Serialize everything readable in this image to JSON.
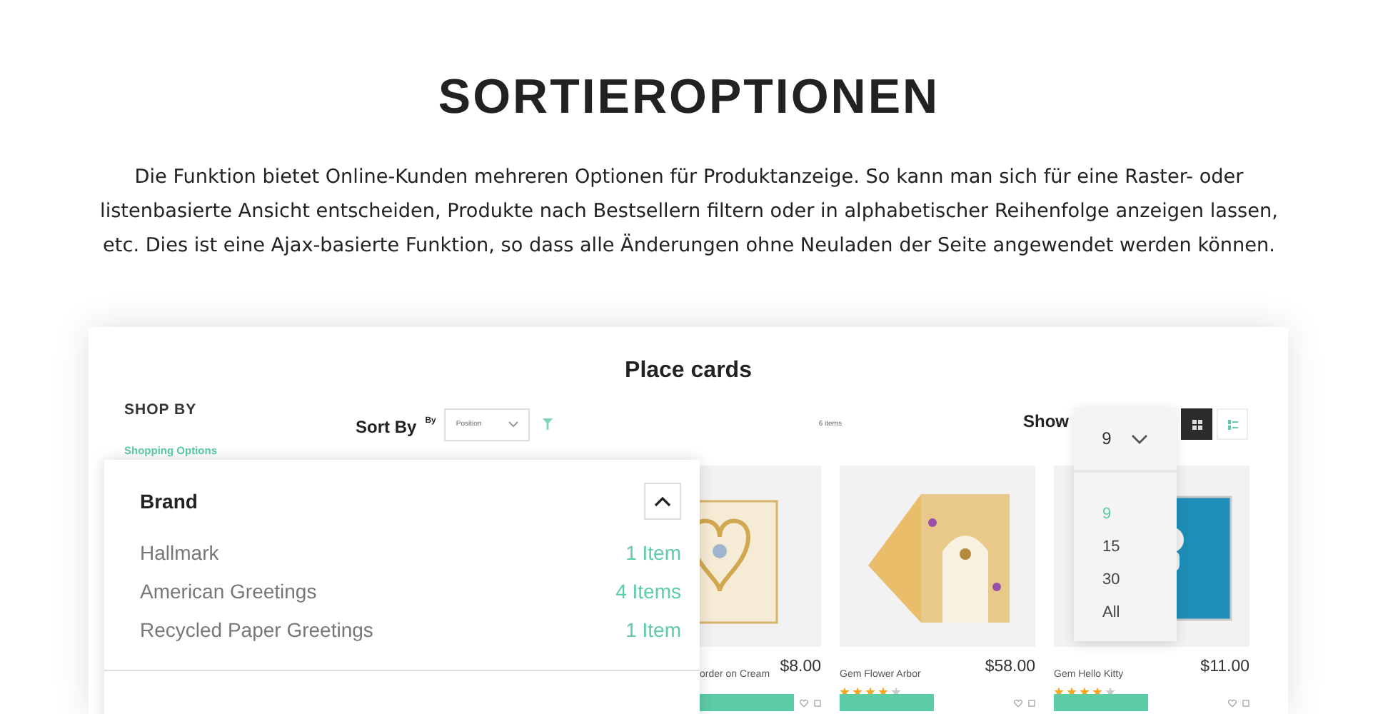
{
  "heading": "SORTIEROPTIONEN",
  "description": "Die Funktion bietet Online-Kunden mehreren Optionen für Produktanzeige. So kann man sich für eine Raster- oder listenbasierte Ansicht entscheiden, Produkte nach Bestsellern filtern oder in alphabetischer Reihenfolge anzeigen lassen, etc. Dies ist eine Ajax-basierte Funktion, so dass alle Änderungen ohne Neuladen der Seite angewendet werden können.",
  "shop": {
    "title": "Place cards",
    "shop_by": "SHOP BY",
    "shopping_options": "Shopping Options",
    "sort": {
      "label": "Sort By",
      "by": "By",
      "value": "Position"
    },
    "count": "6 items",
    "show": {
      "label": "Show",
      "value": "9",
      "options": [
        {
          "label": "9",
          "selected": true
        },
        {
          "label": "15",
          "selected": false
        },
        {
          "label": "30",
          "selected": false
        },
        {
          "label": "All",
          "selected": false
        }
      ]
    },
    "views": [
      {
        "kind": "grid",
        "selected": true
      },
      {
        "kind": "list",
        "selected": false
      }
    ],
    "brand": {
      "title": "Brand",
      "expanded": true,
      "items": [
        {
          "name": "Hallmark",
          "count": "1 Item"
        },
        {
          "name": "American Greetings",
          "count": "4 Items"
        },
        {
          "name": "Recycled Paper Greetings",
          "count": "1 Item"
        }
      ]
    },
    "products": [
      {
        "kind": "heart",
        "name": "order on Cream",
        "price": "$8.00"
      },
      {
        "kind": "arch",
        "name": "Gem Flower Arbor",
        "price": "$58.00",
        "stars": 4
      },
      {
        "kind": "blue",
        "name": "Gem Hello Kitty",
        "price": "$11.00",
        "stars": 4
      }
    ]
  }
}
